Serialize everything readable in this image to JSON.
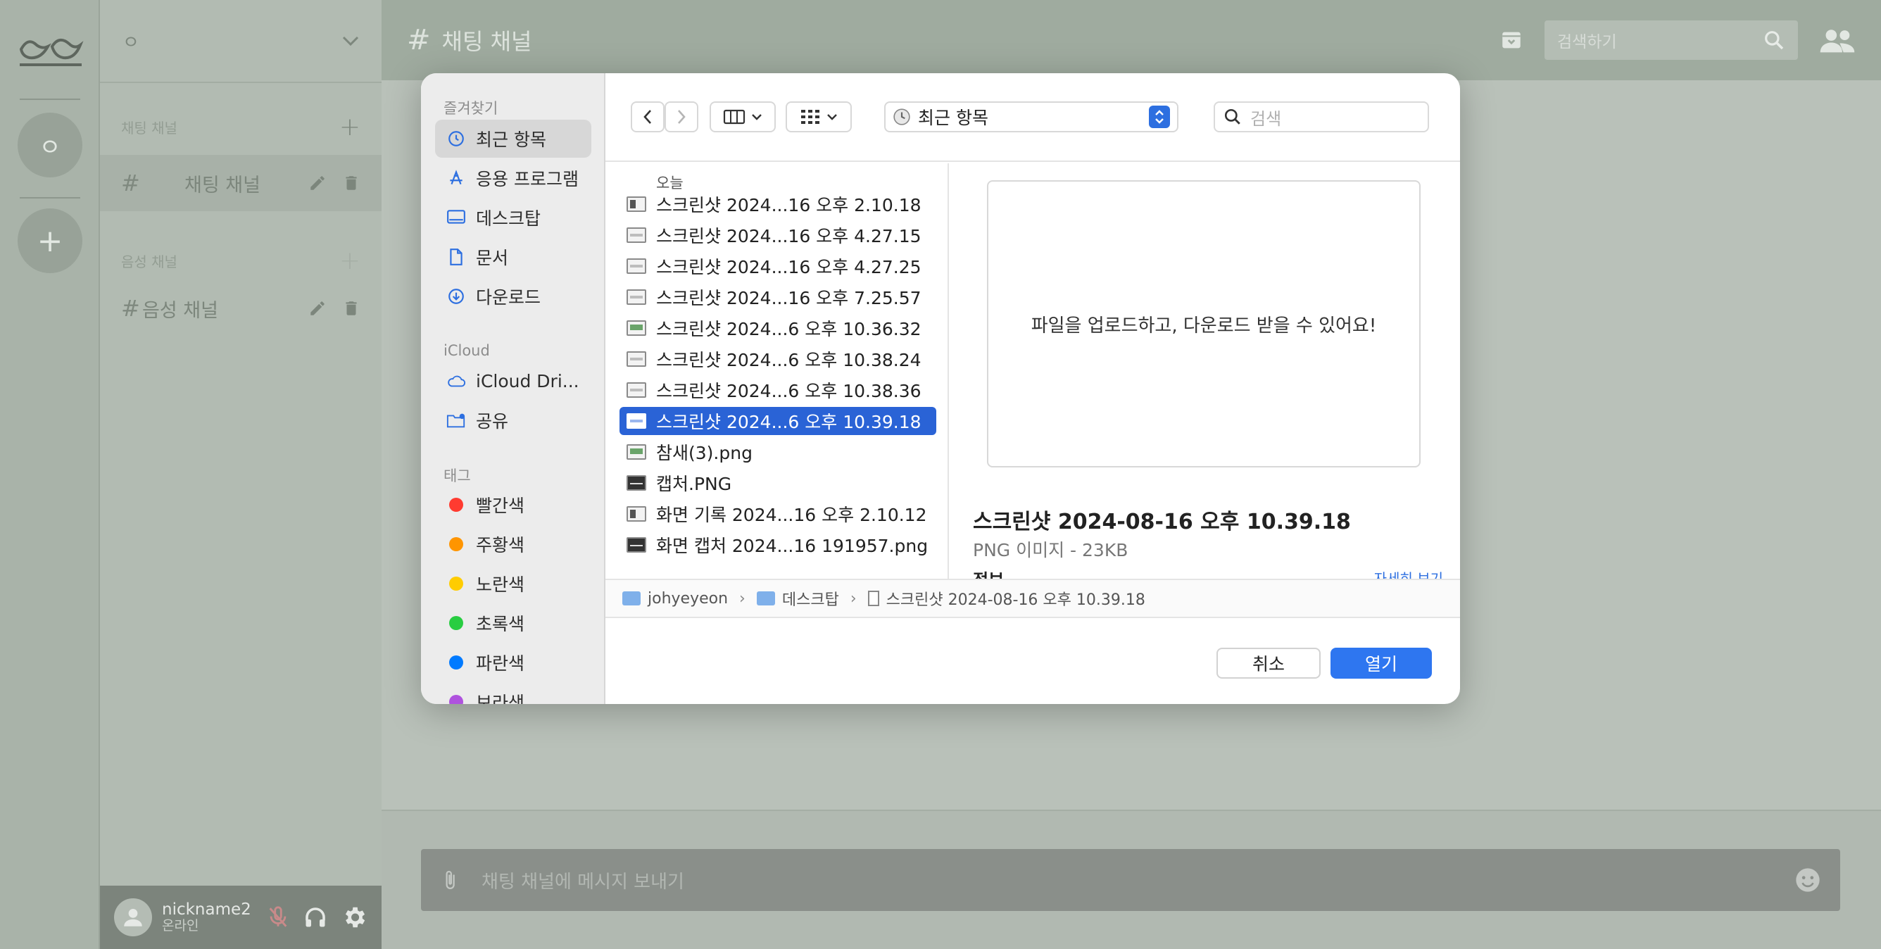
{
  "app": {
    "server_initial": "ㅇ",
    "server_name": "ㅇ",
    "add_server": "+",
    "sections": {
      "text": "채팅 채널",
      "voice": "음성 채널"
    },
    "channels": {
      "text_channel": "채팅 채널",
      "voice_channel": "음성 채널"
    },
    "user": {
      "name": "nickname2",
      "status": "온라인"
    },
    "header": {
      "channel_title": "채팅 채널",
      "search_placeholder": "검색하기"
    },
    "composer": {
      "placeholder": "채팅 채널에 메시지 보내기"
    }
  },
  "dialog": {
    "sidebar": {
      "favorites_label": "즐겨찾기",
      "favorites": [
        "최근 항목",
        "응용 프로그램",
        "데스크탑",
        "문서",
        "다운로드"
      ],
      "icloud_label": "iCloud",
      "icloud": [
        "iCloud Dri...",
        "공유"
      ],
      "tags_label": "태그",
      "tags": [
        {
          "label": "빨간색",
          "color": "#ff3b30"
        },
        {
          "label": "주황색",
          "color": "#ff9500"
        },
        {
          "label": "노란색",
          "color": "#ffcc00"
        },
        {
          "label": "초록색",
          "color": "#28cd41"
        },
        {
          "label": "파란색",
          "color": "#007aff"
        },
        {
          "label": "보라색",
          "color": "#af52de"
        }
      ]
    },
    "toolbar": {
      "location": "최근 항목",
      "search_placeholder": "검색"
    },
    "file_list": {
      "header": "오늘",
      "files": [
        "스크린샷 2024...16 오후 2.10.18",
        "스크린샷 2024...16 오후 4.27.15",
        "스크린샷 2024...16 오후 4.27.25",
        "스크린샷 2024...16 오후 7.25.57",
        "스크린샷 2024...6 오후 10.36.32",
        "스크린샷 2024...6 오후 10.38.24",
        "스크린샷 2024...6 오후 10.38.36",
        "스크린샷 2024...6 오후 10.39.18",
        "참새(3).png",
        "캡처.PNG",
        "화면 기록 2024...16 오후 2.10.12",
        "화면 캡처 2024...16 191957.png"
      ],
      "selected_index": 7
    },
    "preview": {
      "image_text": "파일을 업로드하고, 다운로드 받을 수 있어요!",
      "file_name": "스크린샷 2024-08-16 오후 10.39.18",
      "meta": "PNG 이미지 - 23KB",
      "info_label": "정보",
      "more_link": "자세히 보기"
    },
    "path": {
      "user": "johyeyeon",
      "folder": "데스크탑",
      "file": "스크린샷 2024-08-16 오후 10.39.18"
    },
    "buttons": {
      "cancel": "취소",
      "open": "열기"
    }
  },
  "colors": {
    "accent": "#2e76f0",
    "selection": "#2a63d6"
  }
}
